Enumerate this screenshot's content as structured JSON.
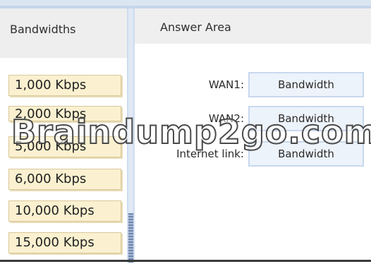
{
  "left_panel": {
    "title": "Bandwidths",
    "items": [
      "1,000 Kbps",
      "2,000 Kbps",
      "5,000 Kbps",
      "6,000 Kbps",
      "10,000 Kbps",
      "15,000 Kbps"
    ]
  },
  "answer_area": {
    "title": "Answer Area",
    "rows": [
      {
        "label": "WAN1:",
        "slot": "Bandwidth"
      },
      {
        "label": "WAN2:",
        "slot": "Bandwidth"
      },
      {
        "label": "Internet link:",
        "slot": "Bandwidth"
      }
    ]
  },
  "watermark": "Braindump2go.com"
}
